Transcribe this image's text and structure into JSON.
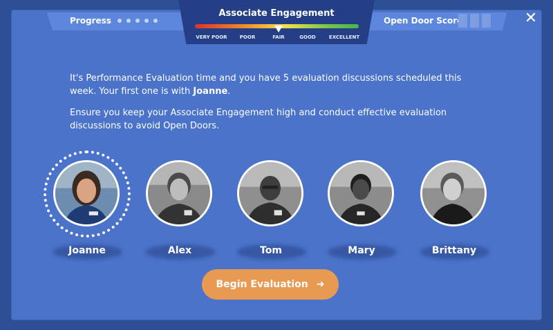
{
  "header": {
    "progress_label": "Progress",
    "progress_dots": 5,
    "meter_title": "Associate Engagement",
    "meter_labels": [
      "VERY POOR",
      "POOR",
      "FAIR",
      "GOOD",
      "EXCELLENT"
    ],
    "meter_value": "FAIR",
    "score_label": "Open Door Score",
    "score_boxes": 3,
    "close_icon": "close-icon"
  },
  "intro": {
    "line1": "It's Performance Evaluation time and you have 5 evaluation discussions scheduled this week. Your first one is with ",
    "line1_name": "Joanne",
    "line1_end": ".",
    "line2": "Ensure you keep your Associate Engagement high and conduct effective evaluation discussions to avoid Open Doors."
  },
  "associates": [
    {
      "name": "Joanne",
      "selected": true
    },
    {
      "name": "Alex",
      "selected": false
    },
    {
      "name": "Tom",
      "selected": false
    },
    {
      "name": "Mary",
      "selected": false
    },
    {
      "name": "Brittany",
      "selected": false
    }
  ],
  "begin_button": {
    "label": "Begin Evaluation",
    "icon": "arrow-right-icon"
  },
  "colors": {
    "panel": "#4a73c9",
    "background": "#2d4f96",
    "button": "#e89a52",
    "meter_bg": "#243f86"
  }
}
